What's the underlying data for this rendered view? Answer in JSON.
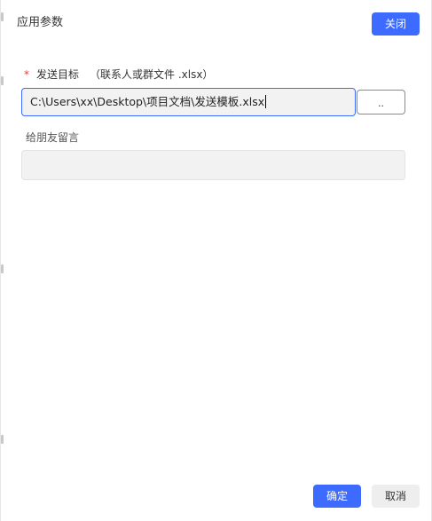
{
  "dialog": {
    "title": "应用参数",
    "close_label": "关闭"
  },
  "target_field": {
    "required_mark": "*",
    "label": "发送目标",
    "hint": "（联系人或群文件 .xlsx）",
    "value": "C:\\Users\\xx\\Desktop\\项目文档\\发送模板.xlsx",
    "browse_label": ".."
  },
  "message_field": {
    "label": "给朋友留言",
    "value": ""
  },
  "footer": {
    "ok_label": "确定",
    "cancel_label": "取消"
  },
  "colors": {
    "primary": "#3d6bff",
    "required": "#e03c3c",
    "input_bg": "#f2f2f2"
  }
}
